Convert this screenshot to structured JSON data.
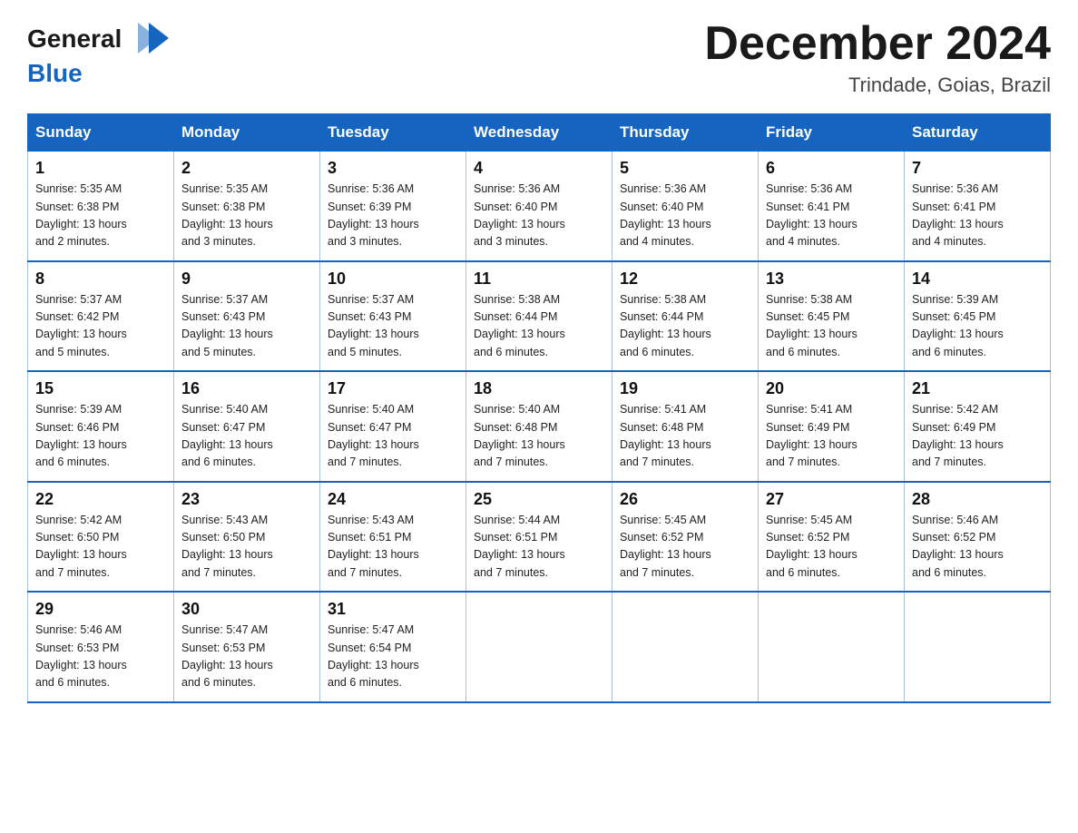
{
  "header": {
    "logo_general": "General",
    "logo_blue": "Blue",
    "month_title": "December 2024",
    "subtitle": "Trindade, Goias, Brazil"
  },
  "days_of_week": [
    "Sunday",
    "Monday",
    "Tuesday",
    "Wednesday",
    "Thursday",
    "Friday",
    "Saturday"
  ],
  "weeks": [
    [
      {
        "day": "1",
        "sunrise": "5:35 AM",
        "sunset": "6:38 PM",
        "daylight": "13 hours and 2 minutes."
      },
      {
        "day": "2",
        "sunrise": "5:35 AM",
        "sunset": "6:38 PM",
        "daylight": "13 hours and 3 minutes."
      },
      {
        "day": "3",
        "sunrise": "5:36 AM",
        "sunset": "6:39 PM",
        "daylight": "13 hours and 3 minutes."
      },
      {
        "day": "4",
        "sunrise": "5:36 AM",
        "sunset": "6:40 PM",
        "daylight": "13 hours and 3 minutes."
      },
      {
        "day": "5",
        "sunrise": "5:36 AM",
        "sunset": "6:40 PM",
        "daylight": "13 hours and 4 minutes."
      },
      {
        "day": "6",
        "sunrise": "5:36 AM",
        "sunset": "6:41 PM",
        "daylight": "13 hours and 4 minutes."
      },
      {
        "day": "7",
        "sunrise": "5:36 AM",
        "sunset": "6:41 PM",
        "daylight": "13 hours and 4 minutes."
      }
    ],
    [
      {
        "day": "8",
        "sunrise": "5:37 AM",
        "sunset": "6:42 PM",
        "daylight": "13 hours and 5 minutes."
      },
      {
        "day": "9",
        "sunrise": "5:37 AM",
        "sunset": "6:43 PM",
        "daylight": "13 hours and 5 minutes."
      },
      {
        "day": "10",
        "sunrise": "5:37 AM",
        "sunset": "6:43 PM",
        "daylight": "13 hours and 5 minutes."
      },
      {
        "day": "11",
        "sunrise": "5:38 AM",
        "sunset": "6:44 PM",
        "daylight": "13 hours and 6 minutes."
      },
      {
        "day": "12",
        "sunrise": "5:38 AM",
        "sunset": "6:44 PM",
        "daylight": "13 hours and 6 minutes."
      },
      {
        "day": "13",
        "sunrise": "5:38 AM",
        "sunset": "6:45 PM",
        "daylight": "13 hours and 6 minutes."
      },
      {
        "day": "14",
        "sunrise": "5:39 AM",
        "sunset": "6:45 PM",
        "daylight": "13 hours and 6 minutes."
      }
    ],
    [
      {
        "day": "15",
        "sunrise": "5:39 AM",
        "sunset": "6:46 PM",
        "daylight": "13 hours and 6 minutes."
      },
      {
        "day": "16",
        "sunrise": "5:40 AM",
        "sunset": "6:47 PM",
        "daylight": "13 hours and 6 minutes."
      },
      {
        "day": "17",
        "sunrise": "5:40 AM",
        "sunset": "6:47 PM",
        "daylight": "13 hours and 7 minutes."
      },
      {
        "day": "18",
        "sunrise": "5:40 AM",
        "sunset": "6:48 PM",
        "daylight": "13 hours and 7 minutes."
      },
      {
        "day": "19",
        "sunrise": "5:41 AM",
        "sunset": "6:48 PM",
        "daylight": "13 hours and 7 minutes."
      },
      {
        "day": "20",
        "sunrise": "5:41 AM",
        "sunset": "6:49 PM",
        "daylight": "13 hours and 7 minutes."
      },
      {
        "day": "21",
        "sunrise": "5:42 AM",
        "sunset": "6:49 PM",
        "daylight": "13 hours and 7 minutes."
      }
    ],
    [
      {
        "day": "22",
        "sunrise": "5:42 AM",
        "sunset": "6:50 PM",
        "daylight": "13 hours and 7 minutes."
      },
      {
        "day": "23",
        "sunrise": "5:43 AM",
        "sunset": "6:50 PM",
        "daylight": "13 hours and 7 minutes."
      },
      {
        "day": "24",
        "sunrise": "5:43 AM",
        "sunset": "6:51 PM",
        "daylight": "13 hours and 7 minutes."
      },
      {
        "day": "25",
        "sunrise": "5:44 AM",
        "sunset": "6:51 PM",
        "daylight": "13 hours and 7 minutes."
      },
      {
        "day": "26",
        "sunrise": "5:45 AM",
        "sunset": "6:52 PM",
        "daylight": "13 hours and 7 minutes."
      },
      {
        "day": "27",
        "sunrise": "5:45 AM",
        "sunset": "6:52 PM",
        "daylight": "13 hours and 6 minutes."
      },
      {
        "day": "28",
        "sunrise": "5:46 AM",
        "sunset": "6:52 PM",
        "daylight": "13 hours and 6 minutes."
      }
    ],
    [
      {
        "day": "29",
        "sunrise": "5:46 AM",
        "sunset": "6:53 PM",
        "daylight": "13 hours and 6 minutes."
      },
      {
        "day": "30",
        "sunrise": "5:47 AM",
        "sunset": "6:53 PM",
        "daylight": "13 hours and 6 minutes."
      },
      {
        "day": "31",
        "sunrise": "5:47 AM",
        "sunset": "6:54 PM",
        "daylight": "13 hours and 6 minutes."
      },
      null,
      null,
      null,
      null
    ]
  ],
  "labels": {
    "sunrise": "Sunrise:",
    "sunset": "Sunset:",
    "daylight": "Daylight:"
  }
}
